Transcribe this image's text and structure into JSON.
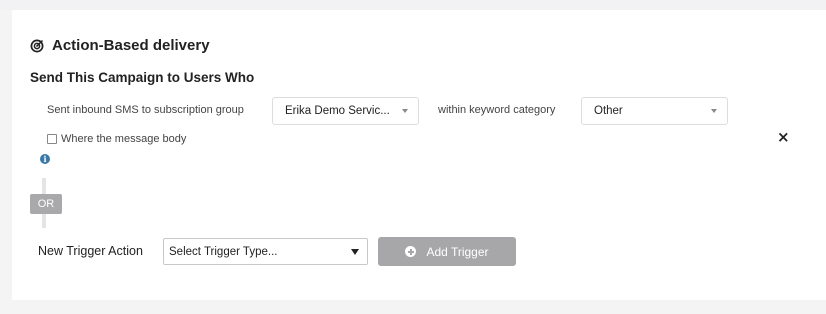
{
  "section": {
    "title": "Action-Based delivery",
    "subtitle": "Send This Campaign to Users Who"
  },
  "trigger": {
    "prefix_label": "Sent inbound SMS to subscription group",
    "group_value": "Erika Demo Servic...",
    "keyword_label": "within keyword category",
    "keyword_value": "Other",
    "checkbox_label": "Where the message body",
    "info_icon": "info-circle",
    "remove_icon": "close"
  },
  "or_badge": "OR",
  "new_trigger": {
    "label": "New Trigger Action",
    "select_value": "Select Trigger Type...",
    "add_button_label": "Add Trigger",
    "add_icon": "plus-circle"
  },
  "colors": {
    "info": "#3b78a8",
    "button_disabled": "#a7a7aa",
    "or_badge": "#a9a9ab"
  }
}
